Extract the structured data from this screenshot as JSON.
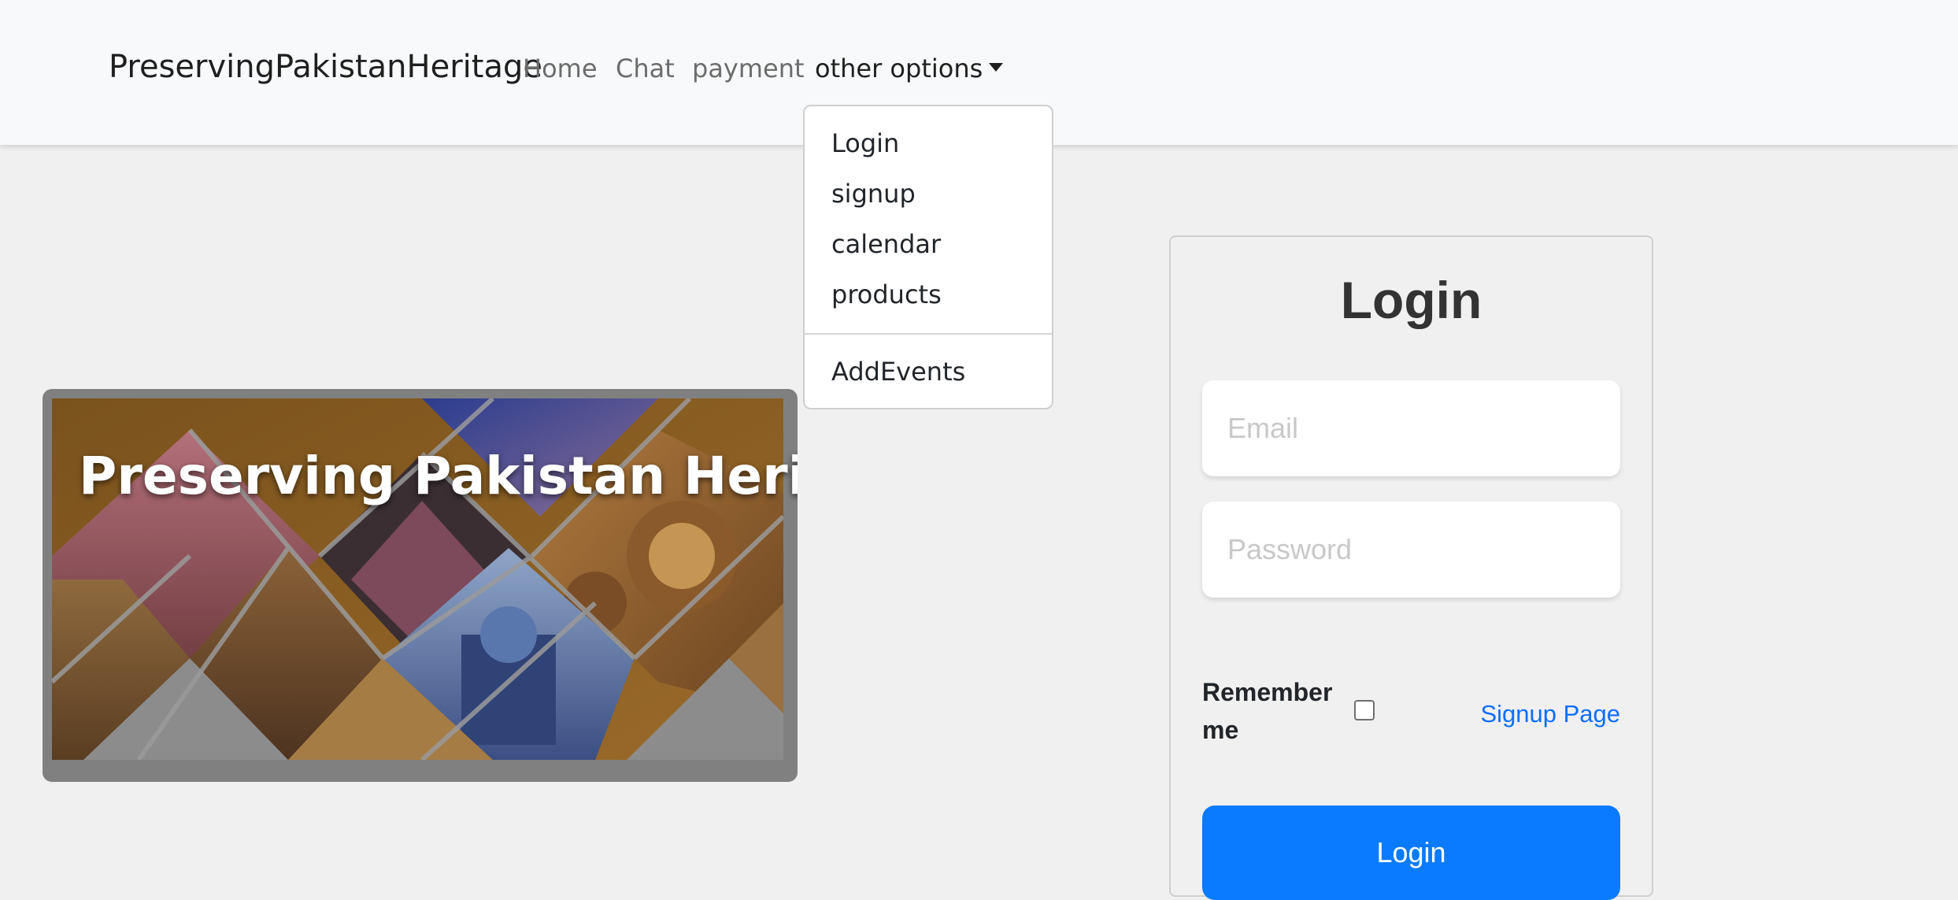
{
  "navbar": {
    "brand": "PreservingPakistanHeritage",
    "links": [
      "Home",
      "Chat",
      "payment"
    ],
    "dropdown_label": "other options"
  },
  "dropdown": {
    "items": [
      "Login",
      "signup",
      "calendar",
      "products"
    ],
    "extra_item": "AddEvents"
  },
  "hero": {
    "title": "Preserving Pakistan Heritage"
  },
  "login_form": {
    "title": "Login",
    "email_placeholder": "Email",
    "password_placeholder": "Password",
    "remember_label": "Remember me",
    "remember_checked": false,
    "signup_link": "Signup Page",
    "submit_label": "Login"
  },
  "colors": {
    "primary": "#0a7bff",
    "link": "#0d6efd",
    "page_bg": "#f0f0f0",
    "navbar_bg": "#f8f9fa"
  }
}
